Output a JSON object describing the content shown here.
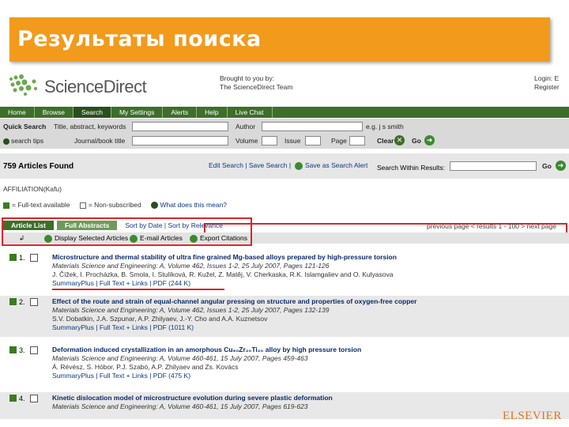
{
  "slide": {
    "title": "Результаты поиска",
    "footer_logo": "ELSEVIER"
  },
  "header": {
    "logo_text": "ScienceDirect",
    "brought_by_line1": "Brought to you by:",
    "brought_by_line2": "The ScienceDirect Team",
    "login_line1": "Login: E",
    "login_line2": "Register"
  },
  "nav": {
    "tabs": [
      "Home",
      "Browse",
      "Search",
      "My Settings",
      "Alerts",
      "Help",
      "Live Chat"
    ],
    "active": "Search"
  },
  "quick_search": {
    "label": "Quick Search",
    "tips": "search tips",
    "field1_label": "Title, abstract, keywords",
    "field2_label": "Journal/book title",
    "author_label": "Author",
    "author_hint": "e.g. j s smith",
    "volume_label": "Volume",
    "issue_label": "Issue",
    "page_label": "Page",
    "clear_label": "Clear",
    "go_label": "Go"
  },
  "results_bar": {
    "found": "759 Articles Found",
    "edit_links": "Edit Search | Save Search |",
    "save_alert": "Save as Search Alert",
    "within_label": "Search Within Results:",
    "go_label": "Go"
  },
  "affiliation": "AFFILIATION(Kafu)",
  "legend": {
    "full_text": "= Full-text available",
    "non_subscribed": "= Non-subscribed",
    "what_means": "What does this mean?"
  },
  "result_tabs": {
    "article_list": "Article List",
    "full_abstracts": "Full Abstracts",
    "sort_text": "Sort by Date | Sort by Relevance",
    "previous_page": "previous page < results 1 - 100 > next page"
  },
  "actions": {
    "display": "Display Selected Articles",
    "email": "E-mail Articles",
    "export": "Export Citations"
  },
  "results": [
    {
      "num": "1.",
      "title": "Microstructure and thermal stability of ultra fine grained Mg-based alloys prepared by high-pressure torsion",
      "journal": "Materials Science and Engineering: A, Volume 462, Issues 1-2, 25 July 2007, Pages 121-126",
      "authors": "J. Čížek, I. Procházka, B. Smola, I. Stulíková, R. Kužel, Z. Matěj, V. Cherkaska, R.K. Islamgaliev and O. Kulyasova",
      "links": "SummaryPlus | Full Text + Links | PDF (244 K)"
    },
    {
      "num": "2.",
      "title": "Effect of the route and strain of equal-channel angular pressing on structure and properties of oxygen-free copper",
      "journal": "Materials Science and Engineering: A, Volume 462, Issues 1-2, 25 July 2007, Pages 132-139",
      "authors": "S.V. Dobatkin, J.A. Szpunar, A.P. Zhilyaev, J.-Y. Cho and A.A. Kuznetsov",
      "links": "SummaryPlus | Full Text + Links | PDF (1011 K)"
    },
    {
      "num": "3.",
      "title": "Deformation induced crystallization in an amorphous Cu₆₀Zr₂₀Ti₂₀ alloy by high pressure torsion",
      "journal": "Materials Science and Engineering: A, Volume 460-461, 15 July 2007, Pages 459-463",
      "authors": "Á. Révész, S. Hóbor, P.J. Szabó, A.P. Zhilyaev and Zs. Kovács",
      "links": "SummaryPlus | Full Text + Links | PDF (475 K)"
    },
    {
      "num": "4.",
      "title": "Kinetic dislocation model of microstructure evolution during severe plastic deformation",
      "journal": "Materials Science and Engineering: A, Volume 460-461, 15 July 2007, Pages 619-623",
      "authors": "",
      "links": ""
    }
  ]
}
